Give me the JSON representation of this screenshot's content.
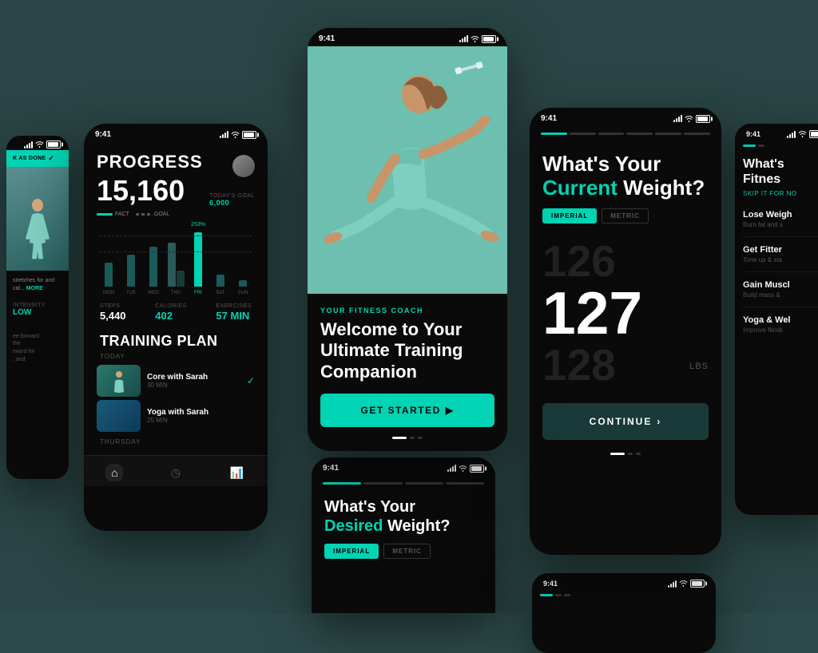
{
  "background": {
    "color": "#2d4a4a"
  },
  "cards": {
    "progress": {
      "time": "9:41",
      "title": "PROGRESS",
      "steps": "15,160",
      "goal_label": "TODAY'S GOAL",
      "goal_value": "6,000",
      "legend_fact": "FACT",
      "legend_goal": "GOAL",
      "bar_percent": "253%",
      "days": [
        "MON",
        "TUE",
        "WED",
        "THU",
        "FRI",
        "SAT",
        "SUN"
      ],
      "stats": {
        "steps_label": "STEPS",
        "steps_val": "5,440",
        "calories_label": "CALORIES",
        "calories_val": "402",
        "exercises_label": "EXERCISES",
        "exercises_val": "57 MIN"
      },
      "training_plan": "TRAINING PLAN",
      "today": "TODAY",
      "workouts": [
        {
          "name": "Core with Sarah",
          "duration": "30 MIN",
          "completed": true
        },
        {
          "name": "Yoga with Sarah",
          "duration": "25 MIN",
          "completed": false
        }
      ],
      "thursday": "THURSDAY"
    },
    "welcome": {
      "time": "9:41",
      "coach_label": "YOUR FITNESS COACH",
      "title": "Welcome to Your Ultimate Training Companion",
      "btn_label": "GET STARTED",
      "btn_arrow": "▶"
    },
    "current_weight": {
      "time": "9:41",
      "title_part1": "What's Your",
      "title_teal": "Current",
      "title_part2": "Weight?",
      "unit_imperial": "IMPERIAL",
      "unit_metric": "METRIC",
      "weight_above": "126",
      "weight_current": "127",
      "weight_below": "128",
      "unit_lbs": "LBS",
      "continue_label": "CONTINUE",
      "continue_arrow": "›"
    },
    "desired_weight": {
      "time": "9:41",
      "title_part1": "What's Your",
      "title_teal": "Desired",
      "title_part2": "Weight?",
      "unit_imperial": "IMPERIAL",
      "unit_metric": "METRIC"
    },
    "fitness_goals": {
      "time": "9:41",
      "title_partial": "What's",
      "title_partial2": "Fitnes",
      "skip_label": "SKIP IT FOR NO",
      "goals": [
        {
          "title": "Lose Weigh",
          "desc": "Burn fat and s"
        },
        {
          "title": "Get Fitter",
          "desc": "Tone up & sta"
        },
        {
          "title": "Gain Muscl",
          "desc": "Build mass &"
        },
        {
          "title": "Yoga & Wel",
          "desc": "Improve flexib"
        }
      ]
    },
    "left_partial": {
      "mark_done": "K AS DONE",
      "intensity_label": "INTENSITY",
      "intensity_val": "LOW",
      "text": "stretches for and cal... MORE"
    }
  }
}
